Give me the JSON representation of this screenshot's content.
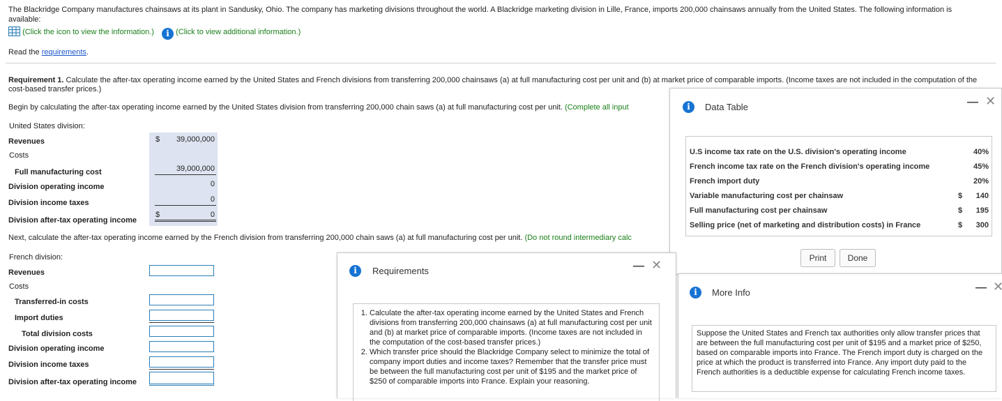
{
  "intro": {
    "text": "The Blackridge Company manufactures chainsaws at its plant in Sandusky, Ohio. The company has marketing divisions throughout the world. A Blackridge marketing division in Lille, France, imports 200,000 chainsaws annually from the United States. The following information is available:",
    "link1": "(Click the icon to view the information.)",
    "link2": "(Click to view additional information.)",
    "read_prefix": "Read the ",
    "read_link": "requirements",
    "read_suffix": "."
  },
  "requirement": {
    "label": "Requirement 1.",
    "text": " Calculate the after-tax operating income earned by the United States and French divisions from transferring 200,000 chainsaws (a) at full manufacturing cost per unit and (b) at market price of comparable imports. (Income taxes are not included in the computation of the cost-based transfer prices.)",
    "begin": "Begin by calculating the after-tax operating income earned by the United States division from transferring 200,000 chain saws (a) at full manufacturing cost per unit. ",
    "begin_green": "(Complete all input",
    "next": "Next, calculate the after-tax operating income earned by the French division from transferring 200,000 chain saws (a) at full manufacturing cost per unit. ",
    "next_green": "(Do not round intermediary calc"
  },
  "us": {
    "title": "United States division:",
    "revenues": "Revenues",
    "costs": "Costs",
    "full_mfg": "Full manufacturing cost",
    "div_op": "Division operating income",
    "div_tax": "Division income taxes",
    "div_after": "Division after-tax operating income",
    "currency": "$",
    "revenues_val": "39,000,000",
    "full_mfg_val": "39,000,000",
    "div_op_val": "0",
    "div_tax_val": "0",
    "div_after_val": "0"
  },
  "fr": {
    "title": "French division:",
    "revenues": "Revenues",
    "costs": "Costs",
    "transferred": "Transferred-in costs",
    "import": "Import duties",
    "total": "Total division costs",
    "div_op": "Division operating income",
    "div_tax": "Division income taxes",
    "div_after": "Division after-tax operating income"
  },
  "data_table": {
    "title": "Data Table",
    "rows": [
      {
        "label": "U.S income tax rate on the U.S. division's operating income",
        "cur": "",
        "val": "40%"
      },
      {
        "label": "French income tax rate on the French division's operating income",
        "cur": "",
        "val": "45%"
      },
      {
        "label": "French import duty",
        "cur": "",
        "val": "20%"
      },
      {
        "label": "Variable manufacturing cost per chainsaw",
        "cur": "$",
        "val": "140"
      },
      {
        "label": "Full manufacturing cost per chainsaw",
        "cur": "$",
        "val": "195"
      },
      {
        "label": "Selling price (net of marketing and distribution costs) in France",
        "cur": "$",
        "val": "300"
      }
    ],
    "print": "Print",
    "done": "Done"
  },
  "requirements_popup": {
    "title": "Requirements",
    "items": [
      "Calculate the after-tax operating income earned by the United States and French divisions from transferring 200,000 chainsaws (a) at full manufacturing cost per unit and (b) at market price of comparable imports. (Income taxes are not included in the computation of the cost-based transfer prices.)",
      "Which transfer price should the Blackridge Company select to minimize the total of company import duties and income taxes? Remember that the transfer price must be between the full manufacturing cost per unit of $195 and the market price of $250 of comparable imports into France. Explain your reasoning."
    ]
  },
  "more_info": {
    "title": "More Info",
    "text": "Suppose the United States and French tax authorities only allow transfer prices that are between the full manufacturing cost per unit of $195 and a market price of $250, based on comparable imports into France. The French import duty is charged on the price at which the product is transferred into France. Any import duty paid to the French authorities is a deductible expense for calculating French income taxes."
  },
  "colors": {
    "accent": "#1673d3",
    "link_green": "#1a7f1a",
    "input_border": "#2b7fb8",
    "shade": "#dde3f0"
  }
}
